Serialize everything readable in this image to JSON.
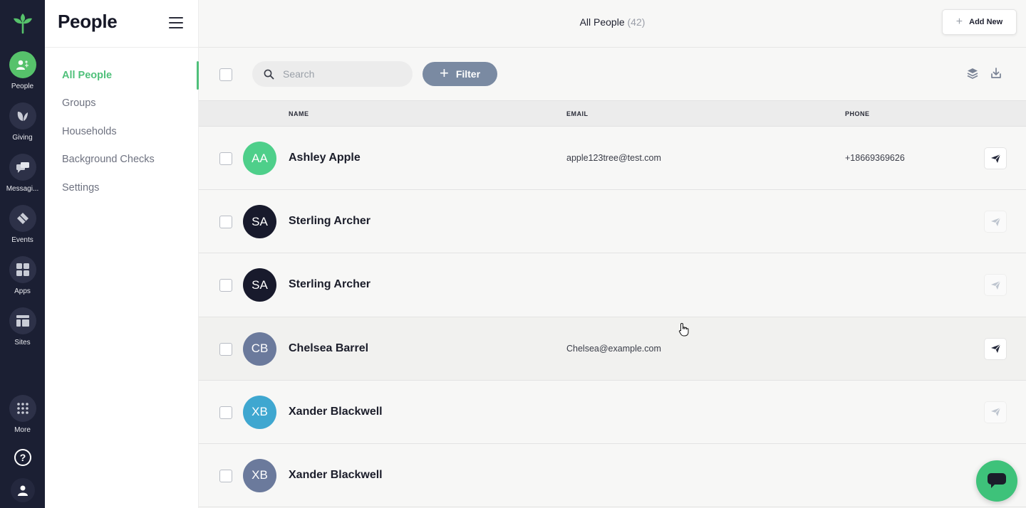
{
  "rail": {
    "items": [
      {
        "label": "People",
        "icon": "people-icon",
        "active": true
      },
      {
        "label": "Giving",
        "icon": "leaf-icon"
      },
      {
        "label": "Messaging",
        "icon": "chat-icon"
      },
      {
        "label": "Events",
        "icon": "ticket-icon"
      },
      {
        "label": "Apps",
        "icon": "grid-icon"
      },
      {
        "label": "Sites",
        "icon": "layout-icon"
      },
      {
        "label": "More",
        "icon": "dots-grid-icon"
      }
    ],
    "help_icon": "help-icon",
    "profile_icon": "user-icon"
  },
  "sidebar": {
    "title": "People",
    "nav": [
      {
        "label": "All People",
        "active": true
      },
      {
        "label": "Groups"
      },
      {
        "label": "Households"
      },
      {
        "label": "Background Checks"
      },
      {
        "label": "Settings"
      }
    ]
  },
  "header": {
    "title": "All People",
    "count": "(42)",
    "add_new_label": "Add New"
  },
  "toolbar": {
    "search_placeholder": "Search",
    "filter_label": "Filter"
  },
  "table": {
    "columns": {
      "name": "NAME",
      "email": "EMAIL",
      "phone": "PHONE"
    },
    "rows": [
      {
        "initials": "AA",
        "name": "Ashley Apple",
        "email": "apple123tree@test.com",
        "phone": "+18669369626",
        "avatar_color": "#4ecf8a",
        "send_enabled": true
      },
      {
        "initials": "SA",
        "name": "Sterling Archer",
        "email": "",
        "phone": "",
        "avatar_color": "#181a2c",
        "send_enabled": false
      },
      {
        "initials": "SA",
        "name": "Sterling Archer",
        "email": "",
        "phone": "",
        "avatar_color": "#181a2c",
        "send_enabled": false
      },
      {
        "initials": "CB",
        "name": "Chelsea Barrel",
        "email": "Chelsea@example.com",
        "phone": "",
        "avatar_color": "#6b7a9c",
        "send_enabled": true
      },
      {
        "initials": "XB",
        "name": "Xander Blackwell",
        "email": "",
        "phone": "",
        "avatar_color": "#3fa7d0",
        "send_enabled": false
      },
      {
        "initials": "XB",
        "name": "Xander Blackwell",
        "email": "",
        "phone": "",
        "avatar_color": "#6b7a9c",
        "send_enabled": false
      }
    ]
  },
  "colors": {
    "accent": "#4fc07a",
    "rail_bg": "#1b1f33",
    "filter_bg": "#7a8aa2",
    "chat_bg": "#3ec27a"
  }
}
